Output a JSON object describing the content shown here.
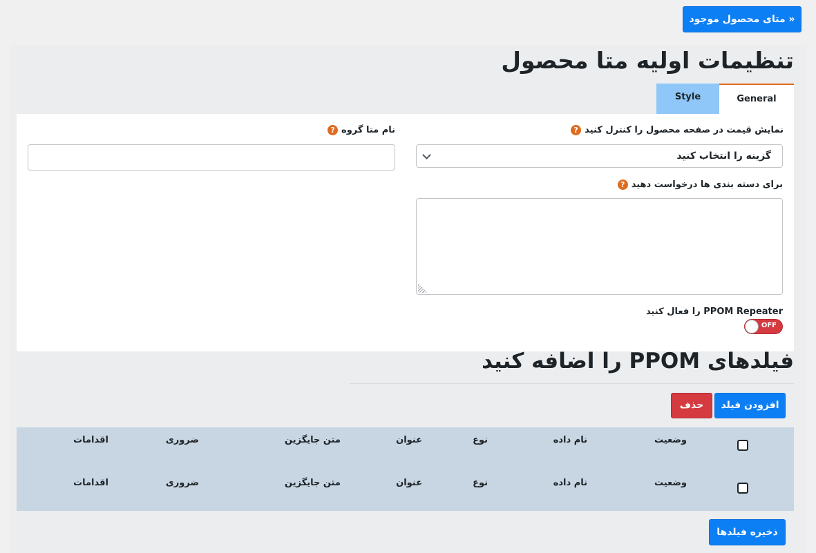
{
  "header": {
    "existing_meta_button": "« متای محصول موجود"
  },
  "settings": {
    "title": "تنظیمات اولیه متا محصول",
    "tabs": [
      {
        "label": "General",
        "active": true
      },
      {
        "label": "Style",
        "active": false
      }
    ],
    "general": {
      "price_label": "نمایش قیمت در صفحه محصول را کنترل کنید",
      "price_select_value": "گزینه را انتخاب کنید",
      "group_name_label": "نام متا گروه",
      "group_name_value": "",
      "category_label": "برای دسته بندی ها درخواست دهید",
      "category_value": "",
      "repeater_label": "PPOM Repeater را فعال کنید",
      "repeater_state": "OFF",
      "help_glyph": "?"
    }
  },
  "fields_section": {
    "title": "فیلدهای PPOM را اضافه کنید",
    "add_button": "افزودن فیلد",
    "delete_button": "حذف",
    "columns": [
      "وضعیت",
      "نام داده",
      "نوع",
      "عنوان",
      "متن جایگزین",
      "ضروری",
      "اقدامات"
    ],
    "rows": [
      {
        "checked": false,
        "cells": [
          "وضعیت",
          "نام داده",
          "نوع",
          "عنوان",
          "متن جایگزین",
          "ضروری",
          "اقدامات"
        ]
      },
      {
        "checked": false,
        "cells": [
          "وضعیت",
          "نام داده",
          "نوع",
          "عنوان",
          "متن جایگزین",
          "ضروری",
          "اقدامات"
        ]
      }
    ],
    "save_button": "ذخیره فیلدها"
  },
  "colors": {
    "primary": "#0d7ff5",
    "danger": "#d43a3f",
    "accent_orange": "#e06b1f",
    "tab_inactive": "#8ec7f8",
    "table_bg": "#c8d6e3"
  }
}
